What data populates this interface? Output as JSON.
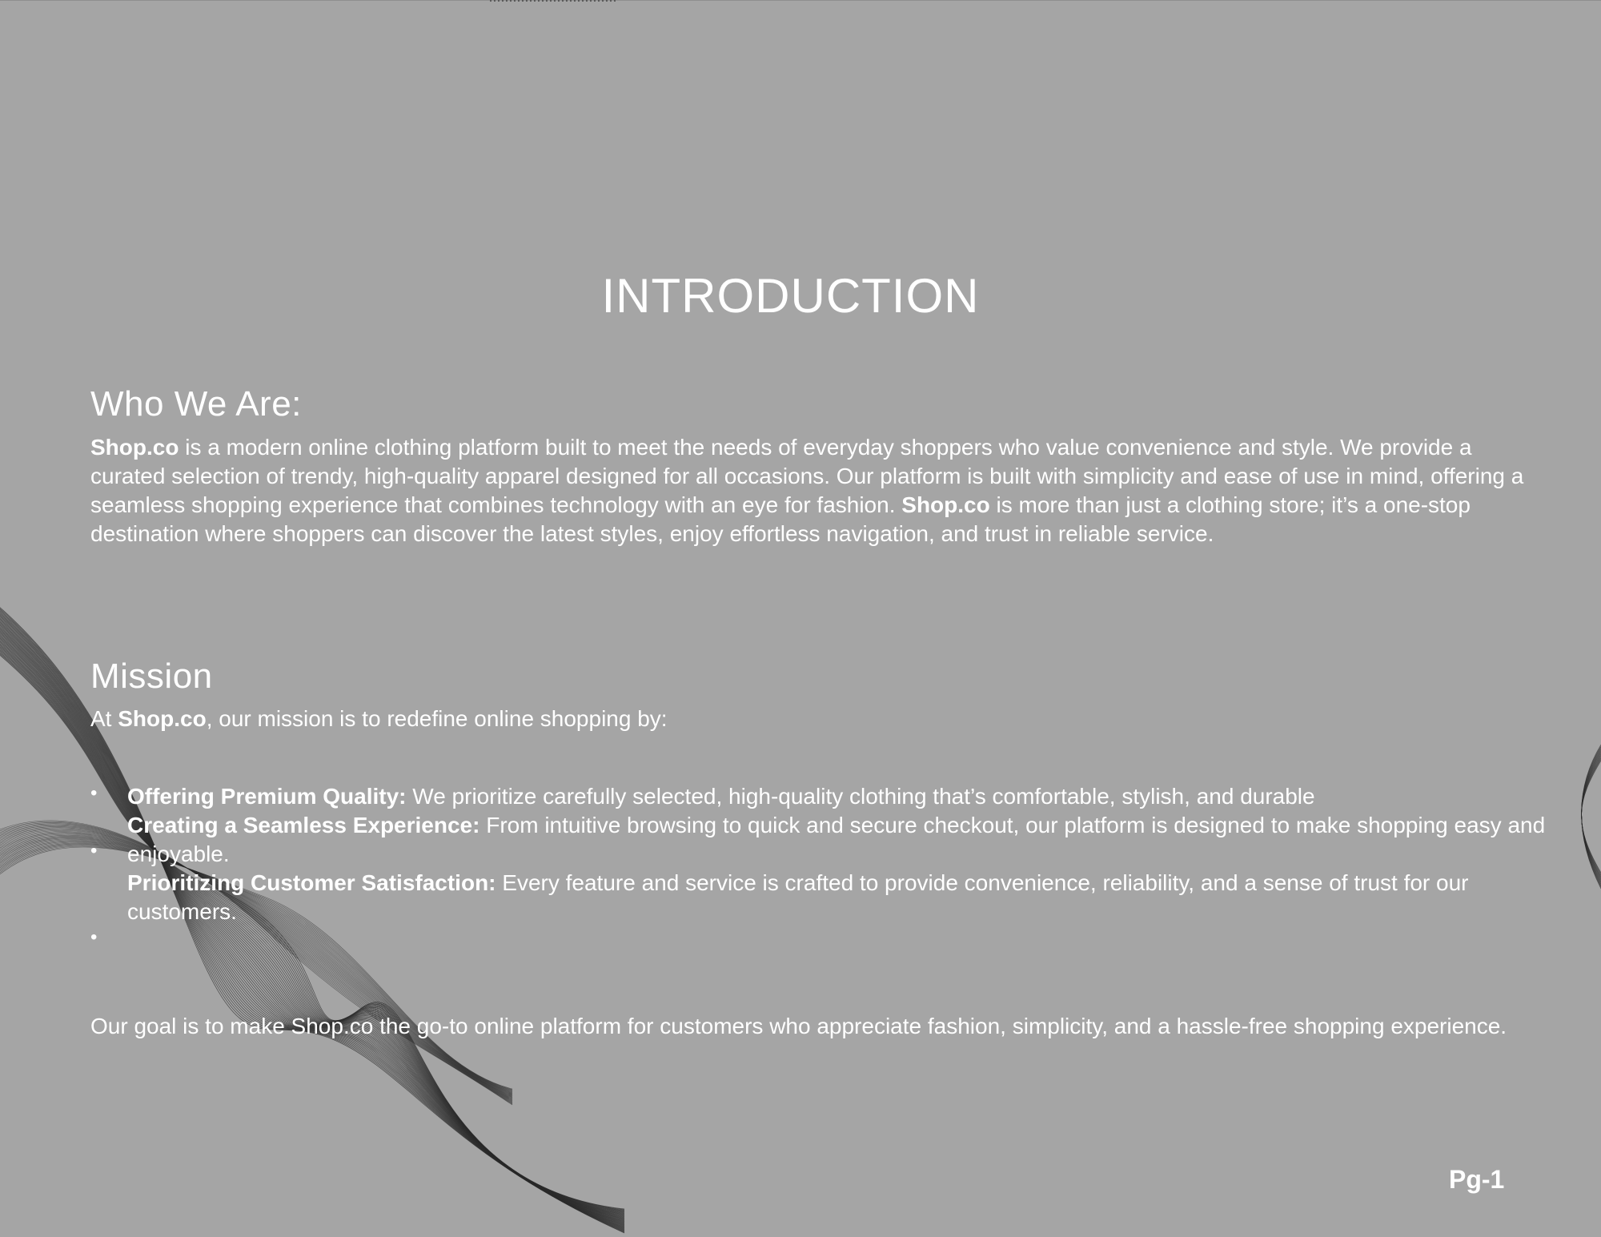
{
  "title": "INTRODUCTION",
  "who": {
    "heading": "Who We Are:",
    "brand": "Shop.co",
    "text1": " is a modern online clothing platform built to meet the needs of everyday shoppers who value convenience and style. We provide a curated selection of trendy, high-quality apparel designed for all occasions. Our platform is built with simplicity and ease of use in mind, offering a seamless shopping experience that combines technology with an eye for fashion. ",
    "brand2": "Shop.co",
    "text2": " is more than just a clothing store; it’s a one-stop destination where shoppers can discover the latest styles, enjoy effortless navigation, and trust in reliable service."
  },
  "mission": {
    "heading": "Mission",
    "intro_prefix": "At ",
    "intro_brand": "Shop.co",
    "intro_suffix": ", our mission is to redefine online shopping by:",
    "items": [
      {
        "label": "Offering Premium Quality:",
        "text": " We prioritize carefully selected, high-quality clothing that’s comfortable, stylish, and durable"
      },
      {
        "label": "Creating a Seamless Experience:",
        "text": " From intuitive browsing to quick and secure checkout, our platform is designed to make shopping easy and enjoyable."
      },
      {
        "label": "Prioritizing Customer Satisfaction:",
        "text": " Every feature and service is crafted to provide convenience, reliability, and a sense of trust for our customers."
      }
    ],
    "bullet": "•",
    "goal": "Our goal is to make Shop.co the go-to online platform for customers who appreciate fashion, simplicity, and a hassle-free shopping experience."
  },
  "page_number": "Pg-1"
}
